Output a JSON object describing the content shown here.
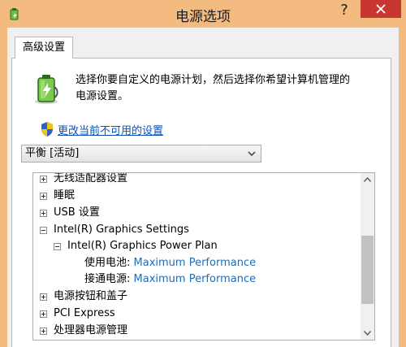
{
  "window": {
    "title": "电源选项",
    "help_label": "?",
    "close_icon": "close-icon",
    "app_icon": "power-options-icon",
    "titlebar_color": "#f3bb80",
    "close_color": "#c7372f"
  },
  "tab": {
    "label": "高级设置"
  },
  "description": {
    "line1": "选择你要自定义的电源计划，然后选择你希望计算机管理的",
    "line2": "电源设置。"
  },
  "admin_link": {
    "label": "更改当前不可用的设置",
    "icon": "shield-icon"
  },
  "plan_select": {
    "value": "平衡 [活动]"
  },
  "tree": {
    "items": [
      {
        "label": "无线适配器设置",
        "state": "collapsed"
      },
      {
        "label": "睡眠",
        "state": "collapsed"
      },
      {
        "label": "USB 设置",
        "state": "collapsed"
      },
      {
        "label": "Intel(R) Graphics Settings",
        "state": "expanded"
      },
      {
        "label": "Intel(R) Graphics Power Plan",
        "state": "expanded"
      },
      {
        "label": "使用电池:",
        "value": "Maximum Performance"
      },
      {
        "label": "接通电源:",
        "value": "Maximum Performance"
      },
      {
        "label": "电源按钮和盖子",
        "state": "collapsed"
      },
      {
        "label": "PCI Express",
        "state": "collapsed"
      },
      {
        "label": "处理器电源管理",
        "state": "collapsed"
      }
    ]
  },
  "scrollbar": {
    "position_fraction": 0.45
  }
}
